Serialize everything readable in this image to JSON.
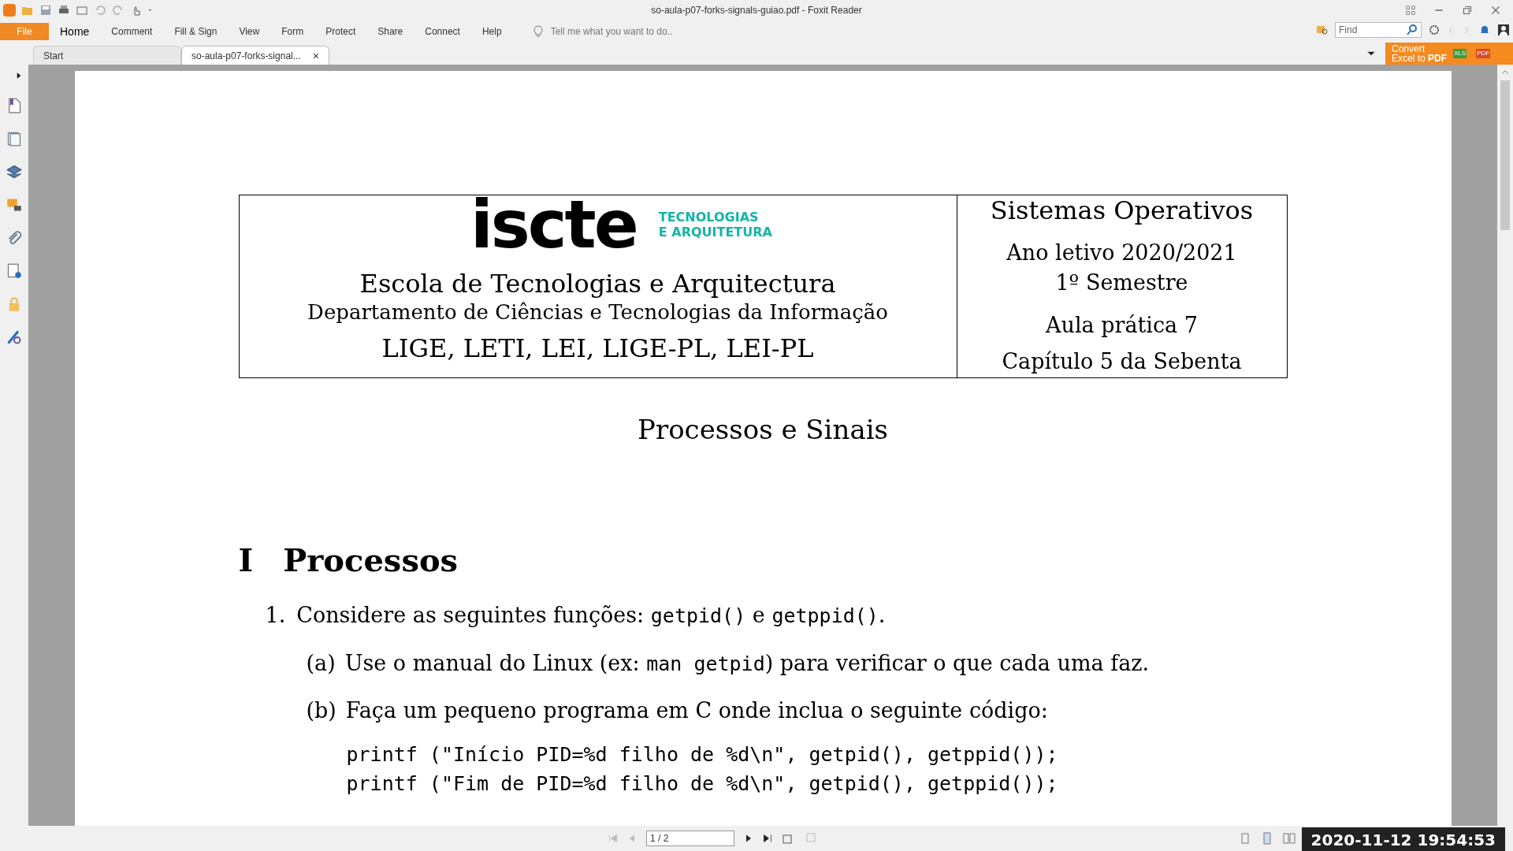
{
  "window": {
    "title": "so-aula-p07-forks-signals-guiao.pdf - Foxit Reader"
  },
  "menu": [
    {
      "label": "File",
      "selected": false,
      "kind": "file"
    },
    {
      "label": "Home",
      "selected": true,
      "kind": "tab"
    },
    {
      "label": "Comment",
      "selected": false,
      "kind": "tab"
    },
    {
      "label": "Fill & Sign",
      "selected": false,
      "kind": "tab"
    },
    {
      "label": "View",
      "selected": false,
      "kind": "tab"
    },
    {
      "label": "Form",
      "selected": false,
      "kind": "tab"
    },
    {
      "label": "Protect",
      "selected": false,
      "kind": "tab"
    },
    {
      "label": "Share",
      "selected": false,
      "kind": "tab"
    },
    {
      "label": "Connect",
      "selected": false,
      "kind": "tab"
    },
    {
      "label": "Help",
      "selected": false,
      "kind": "tab"
    }
  ],
  "tell_me": {
    "placeholder": "Tell me what you want to do.."
  },
  "find": {
    "placeholder": "Find"
  },
  "promo": {
    "line1": "Convert",
    "line2a": "Excel to ",
    "line2b": "PDF",
    "badge1": "XLS",
    "badge2": "PDF"
  },
  "doc_tabs": [
    {
      "label": "Start",
      "selected": false,
      "closable": false
    },
    {
      "label": "so-aula-p07-forks-signal...",
      "selected": true,
      "closable": true
    }
  ],
  "close_glyph": "×",
  "document": {
    "logo": {
      "word": "iscte",
      "line1": "TECNOLOGIAS",
      "line2": "E ARQUITETURA"
    },
    "left_lines": [
      {
        "text": "Escola de Tecnologias e Arquitectura",
        "kind": "large"
      },
      {
        "text": "Departamento de Ciências e Tecnologias da Informação",
        "kind": "small"
      },
      {
        "text": "LIGE, LETI, LEI, LIGE-PL, LEI-PL",
        "kind": "large"
      }
    ],
    "right_lines": [
      {
        "text": "Sistemas Operativos",
        "kind": "title"
      },
      {
        "text": "Ano letivo 2020/2021",
        "kind": "line"
      },
      {
        "text": "1º Semestre",
        "kind": "line"
      },
      {
        "text": "Aula prática 7",
        "kind": "spaced"
      },
      {
        "text": "Capítulo 5 da Sebenta",
        "kind": "line"
      }
    ],
    "title": "Processos e Sinais",
    "section": {
      "number": "I",
      "title": "Processos"
    },
    "items": [
      {
        "marker": "1.",
        "segments": [
          {
            "kind": "text",
            "text": "Considere as seguintes funções: "
          },
          {
            "kind": "code",
            "text": "getpid()"
          },
          {
            "kind": "text",
            "text": " e "
          },
          {
            "kind": "code",
            "text": "getppid()"
          },
          {
            "kind": "text",
            "text": "."
          }
        ],
        "children": [
          {
            "marker": "(a)",
            "segments": [
              {
                "kind": "text",
                "text": "Use o manual do Linux (ex: "
              },
              {
                "kind": "code",
                "text": "man getpid"
              },
              {
                "kind": "text",
                "text": ") para verificar o que cada uma faz."
              }
            ]
          },
          {
            "marker": "(b)",
            "segments": [
              {
                "kind": "text",
                "text": "Faça um pequeno programa em C onde inclua o seguinte código:"
              }
            ],
            "code": [
              "printf (\"Início PID=%d filho de %d\\n\", getpid(), getppid());",
              "printf (\"Fim de PID=%d filho de %d\\n\", getpid(), getppid());"
            ]
          }
        ]
      }
    ]
  },
  "page_nav": {
    "value": "1 / 2"
  },
  "timestamp": "2020-11-12 19:54:53"
}
